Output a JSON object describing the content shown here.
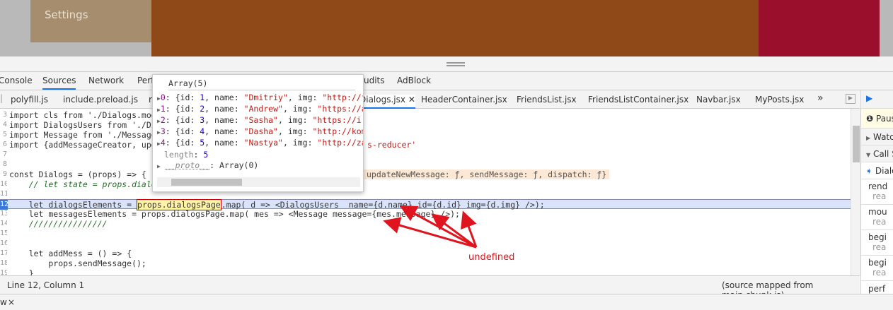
{
  "page": {
    "settings_label": "Settings",
    "colors": {
      "tan": "#a58d6e",
      "brown": "#8f4919",
      "crimson": "#9a0f2c"
    }
  },
  "panel_tabs": [
    "Console",
    "Sources",
    "Network",
    "Perf",
    "udits",
    "AdBlock"
  ],
  "file_tabs": [
    "polyfill.js",
    "include.preload.js",
    "r",
    "Dialogs.jsx",
    "HeaderContainer.jsx",
    "FriendsList.jsx",
    "FriendsListContainer.jsx",
    "Navbar.jsx",
    "MyPosts.jsx"
  ],
  "more_tabs_icon": "»",
  "code_lines": [
    {
      "n": "3",
      "t": "import cls from './Dialogs.modu"
    },
    {
      "n": "4",
      "t": "import DialogsUsers from './Dia"
    },
    {
      "n": "5",
      "t": "import Message from './Messages"
    },
    {
      "n": "6",
      "t": "import {addMessageCreator, upda",
      "tail": "s-reducer'"
    },
    {
      "n": "7",
      "t": ""
    },
    {
      "n": "8",
      "t": ""
    },
    {
      "n": "9",
      "t": "const Dialogs = (props) => {",
      "inline": "updateNewMessage: ƒ, sendMessage: ƒ, dispatch: ƒ}"
    },
    {
      "n": "10",
      "t": "    // let state = props.dialog"
    },
    {
      "n": "11",
      "t": ""
    },
    {
      "n": "12",
      "a": "    let dialogsElements = ",
      "b": "props.dialogsPage",
      ".c": "",
      "c": ".map( d => <DialogsUsers  name={d.name} id={d.id} img={d.img} />);"
    },
    {
      "n": "13",
      "t": "    let messagesElements = props.dialogsPage.map( mes => <Message message={mes.message} />);"
    },
    {
      "n": "14",
      "t": "    ////////////////"
    },
    {
      "n": "15",
      "t": ""
    },
    {
      "n": "16",
      "t": ""
    },
    {
      "n": "17",
      "t": "    let addMess = () => {"
    },
    {
      "n": "18",
      "t": "        props.sendMessage();"
    },
    {
      "n": "19",
      "t": "    }"
    }
  ],
  "popup": {
    "title": "Array(5)",
    "items": [
      {
        "idx": "0",
        "id": "1",
        "name": "\"Dmitriy\"",
        "img": "\"http://f"
      },
      {
        "idx": "1",
        "id": "2",
        "name": "\"Andrew\"",
        "img": "\"https://a"
      },
      {
        "idx": "2",
        "id": "3",
        "name": "\"Sasha\"",
        "img": "\"https://i."
      },
      {
        "idx": "3",
        "id": "4",
        "name": "\"Dasha\"",
        "img": "\"http://kom"
      },
      {
        "idx": "4",
        "id": "5",
        "name": "\"Nastya\"",
        "img": "\"http://za"
      }
    ],
    "length_label": "length",
    "length_value": "5",
    "proto_label": "__proto__",
    "proto_value": "Array(0)"
  },
  "annotation": "undefined",
  "status": {
    "position": "Line 12, Column 1",
    "source_prefix": "(source mapped from ",
    "source_link": "main.chunk.js",
    "source_suffix": ")"
  },
  "drawer": {
    "tab_fragment": "w",
    "close": "×"
  },
  "sidebar": {
    "paused": "Paus",
    "watch": "Watc",
    "callstack": "Call S",
    "frames": [
      {
        "fn": "Dialo"
      },
      {
        "fn": "rend",
        "src": "rea"
      },
      {
        "fn": "mou",
        "src": "rea"
      },
      {
        "fn": "begi",
        "src": "rea"
      },
      {
        "fn": "begi",
        "src": "rea"
      },
      {
        "fn": "perf"
      }
    ]
  }
}
